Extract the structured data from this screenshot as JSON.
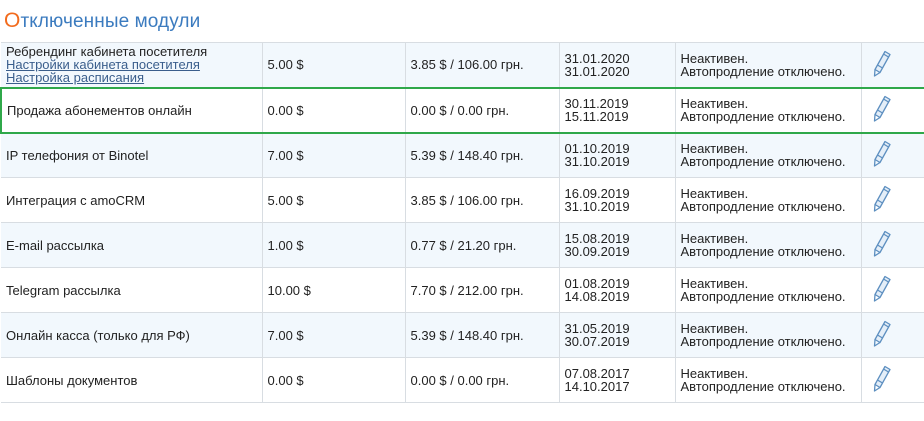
{
  "section": {
    "title_first_letter": "О",
    "title_rest": "тключенные модули"
  },
  "colors": {
    "accent_orange": "#f26b1d",
    "title_blue": "#3b7bbf",
    "link": "#3a5e8c",
    "selected_border": "#2fa84a",
    "row_alt": "#f2f8fd"
  },
  "rows": [
    {
      "name": "Ребрендинг кабинета посетителя",
      "links": [
        "Настройки кабинета посетителя",
        "Настройка расписания"
      ],
      "price": "5.00 $",
      "converted": "3.85 $ / 106.00 грн.",
      "date_from": "31.01.2020",
      "date_to": "31.01.2020",
      "status": "Неактивен.",
      "renewal": "Автопродление отключено.",
      "icon": "pencil-icon"
    },
    {
      "name": "Продажа абонементов онлайн",
      "links": [],
      "price": "0.00 $",
      "converted": "0.00 $ / 0.00 грн.",
      "date_from": "30.11.2019",
      "date_to": "15.11.2019",
      "status": "Неактивен.",
      "renewal": "Автопродление отключено.",
      "icon": "pencil-icon"
    },
    {
      "name": "IP телефония от Binotel",
      "links": [],
      "price": "7.00 $",
      "converted": "5.39 $ / 148.40 грн.",
      "date_from": "01.10.2019",
      "date_to": "31.10.2019",
      "status": "Неактивен.",
      "renewal": "Автопродление отключено.",
      "icon": "pencil-icon"
    },
    {
      "name": "Интеграция с amoCRM",
      "links": [],
      "price": "5.00 $",
      "converted": "3.85 $ / 106.00 грн.",
      "date_from": "16.09.2019",
      "date_to": "31.10.2019",
      "status": "Неактивен.",
      "renewal": "Автопродление отключено.",
      "icon": "pencil-icon"
    },
    {
      "name": "E-mail рассылка",
      "links": [],
      "price": "1.00 $",
      "converted": "0.77 $ / 21.20 грн.",
      "date_from": "15.08.2019",
      "date_to": "30.09.2019",
      "status": "Неактивен.",
      "renewal": "Автопродление отключено.",
      "icon": "pencil-icon"
    },
    {
      "name": "Telegram рассылка",
      "links": [],
      "price": "10.00 $",
      "converted": "7.70 $ / 212.00 грн.",
      "date_from": "01.08.2019",
      "date_to": "14.08.2019",
      "status": "Неактивен.",
      "renewal": "Автопродление отключено.",
      "icon": "pencil-icon"
    },
    {
      "name": "Онлайн касса (только для РФ)",
      "links": [],
      "price": "7.00 $",
      "converted": "5.39 $ / 148.40 грн.",
      "date_from": "31.05.2019",
      "date_to": "30.07.2019",
      "status": "Неактивен.",
      "renewal": "Автопродление отключено.",
      "icon": "pencil-icon"
    },
    {
      "name": "Шаблоны документов",
      "links": [],
      "price": "0.00 $",
      "converted": "0.00 $ / 0.00 грн.",
      "date_from": "07.08.2017",
      "date_to": "14.10.2017",
      "status": "Неактивен.",
      "renewal": "Автопродление отключено.",
      "icon": "pencil-icon"
    }
  ]
}
